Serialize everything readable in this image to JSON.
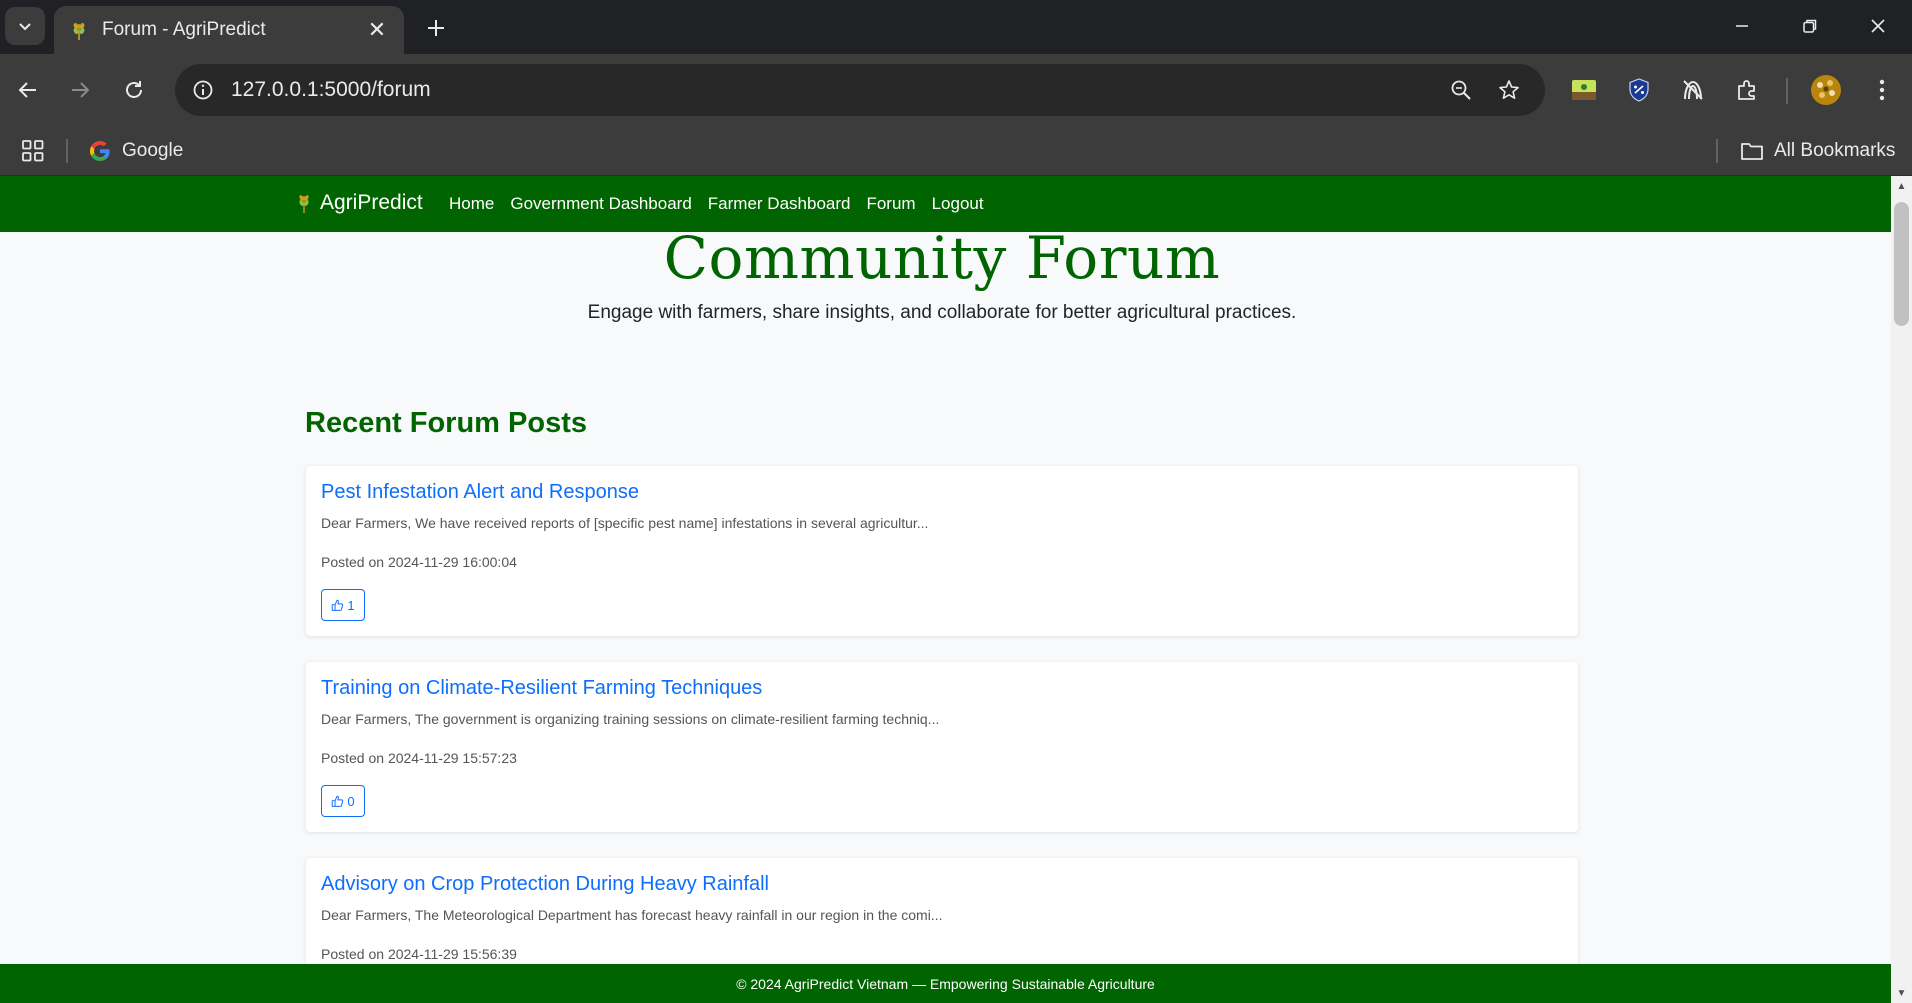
{
  "browser": {
    "tab_title": "Forum - AgriPredict",
    "url": "127.0.0.1:5000/forum",
    "bookmarks": {
      "google_label": "Google",
      "all_bookmarks_label": "All Bookmarks"
    }
  },
  "site": {
    "brand": "AgriPredict",
    "nav": [
      "Home",
      "Government Dashboard",
      "Farmer Dashboard",
      "Forum",
      "Logout"
    ],
    "nav_color": "#006400"
  },
  "hero": {
    "title": "Community Forum",
    "subtitle": "Engage with farmers, share insights, and collaborate for better agricultural practices."
  },
  "section": {
    "title": "Recent Forum Posts"
  },
  "posts": [
    {
      "title": "Pest Infestation Alert and Response",
      "excerpt": "Dear Farmers, We have received reports of [specific pest name] infestations in several agricultur...",
      "meta": "Posted on 2024-11-29 16:00:04",
      "likes": "1"
    },
    {
      "title": "Training on Climate-Resilient Farming Techniques",
      "excerpt": "Dear Farmers, The government is organizing training sessions on climate-resilient farming techniq...",
      "meta": "Posted on 2024-11-29 15:57:23",
      "likes": "0"
    },
    {
      "title": "Advisory on Crop Protection During Heavy Rainfall",
      "excerpt": "Dear Farmers, The Meteorological Department has forecast heavy rainfall in our region in the comi...",
      "meta": "Posted on 2024-11-29 15:56:39",
      "likes": ""
    }
  ],
  "footer": {
    "text": "© 2024 AgriPredict Vietnam — Empowering Sustainable Agriculture"
  }
}
